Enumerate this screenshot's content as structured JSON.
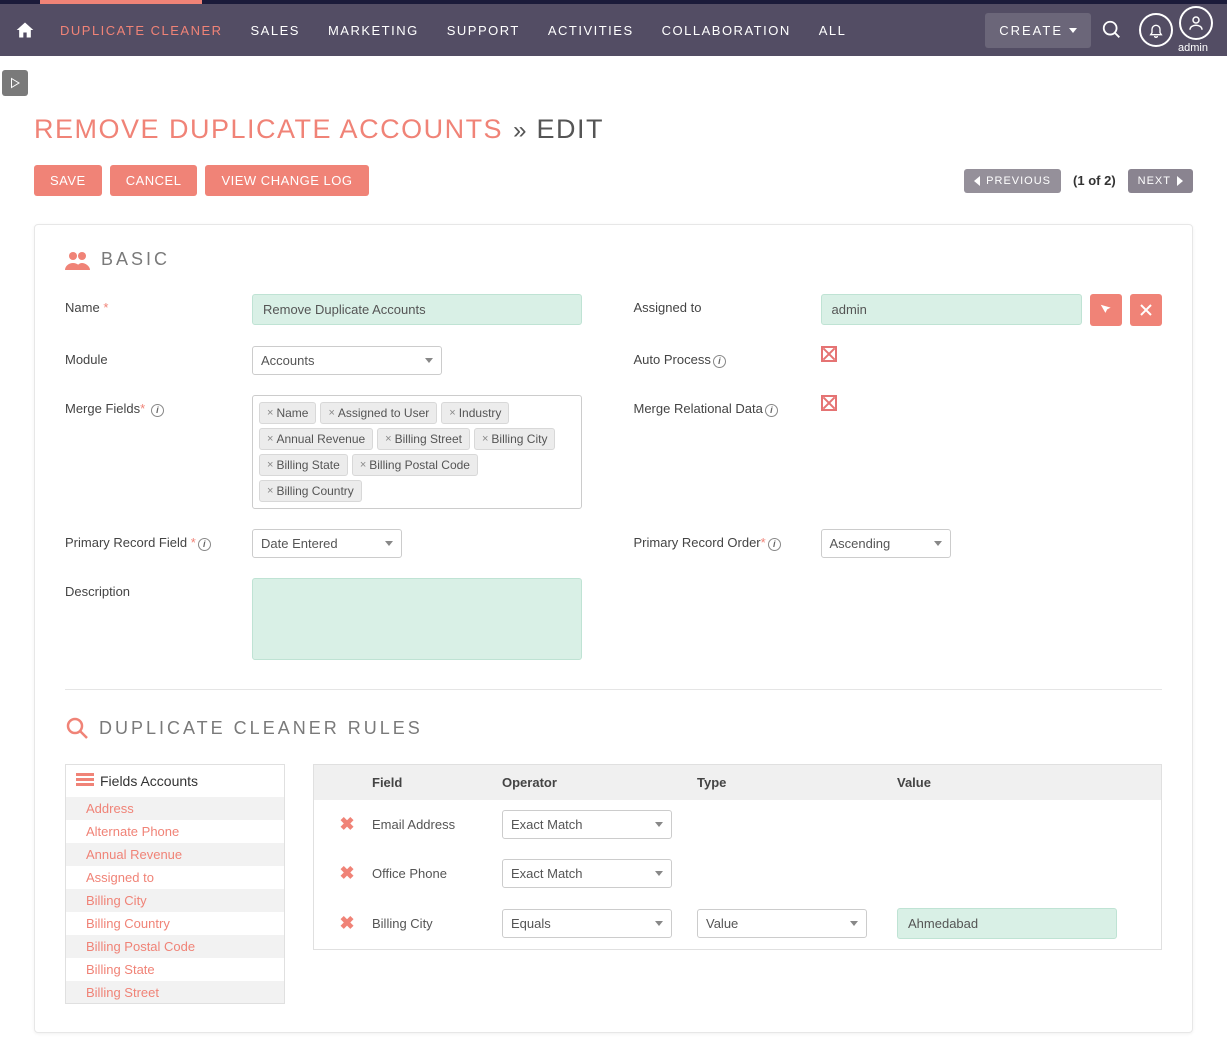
{
  "nav": {
    "items": [
      "DUPLICATE CLEANER",
      "SALES",
      "MARKETING",
      "SUPPORT",
      "ACTIVITIES",
      "COLLABORATION",
      "ALL"
    ],
    "active_index": 0,
    "create_label": "CREATE",
    "admin_label": "admin"
  },
  "page": {
    "title_link": "REMOVE DUPLICATE ACCOUNTS",
    "separator": "»",
    "subtitle": "EDIT"
  },
  "actions": {
    "save": "SAVE",
    "cancel": "CANCEL",
    "changelog": "VIEW CHANGE LOG",
    "previous": "PREVIOUS",
    "next": "NEXT",
    "pager": "(1 of 2)"
  },
  "basic": {
    "section_title": "BASIC",
    "name_label": "Name",
    "name_value": "Remove Duplicate Accounts",
    "module_label": "Module",
    "module_value": "Accounts",
    "merge_fields_label": "Merge Fields",
    "merge_fields": [
      "Name",
      "Assigned to User",
      "Industry",
      "Annual Revenue",
      "Billing Street",
      "Billing City",
      "Billing State",
      "Billing Postal Code",
      "Billing Country"
    ],
    "primary_record_field_label": "Primary Record Field",
    "primary_record_field_value": "Date Entered",
    "description_label": "Description",
    "description_value": "",
    "assigned_to_label": "Assigned to",
    "assigned_to_value": "admin",
    "auto_process_label": "Auto Process",
    "merge_relational_label": "Merge Relational Data",
    "primary_record_order_label": "Primary Record Order",
    "primary_record_order_value": "Ascending"
  },
  "rules": {
    "section_title": "DUPLICATE CLEANER RULES",
    "fields_panel_title": "Fields Accounts",
    "available_fields": [
      "Address",
      "Alternate Phone",
      "Annual Revenue",
      "Assigned to",
      "Billing City",
      "Billing Country",
      "Billing Postal Code",
      "Billing State",
      "Billing Street"
    ],
    "columns": {
      "field": "Field",
      "operator": "Operator",
      "type": "Type",
      "value": "Value"
    },
    "rows": [
      {
        "field": "Email Address",
        "operator": "Exact Match",
        "type": "",
        "value": ""
      },
      {
        "field": "Office Phone",
        "operator": "Exact Match",
        "type": "",
        "value": ""
      },
      {
        "field": "Billing City",
        "operator": "Equals",
        "type": "Value",
        "value": "Ahmedabad"
      }
    ]
  }
}
